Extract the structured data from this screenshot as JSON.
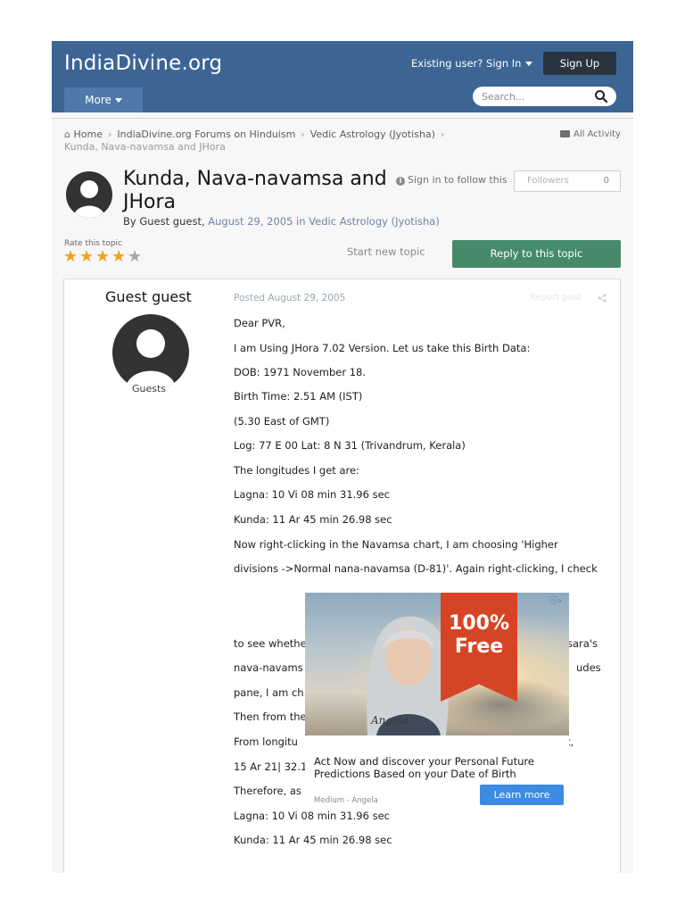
{
  "header": {
    "logo": "IndiaDivine.org",
    "signin": "Existing user? Sign In",
    "signup": "Sign Up",
    "more": "More",
    "search_placeholder": "Search..."
  },
  "breadcrumb": {
    "items": [
      "Home",
      "IndiaDivine.org Forums on Hinduism",
      "Vedic Astrology (Jyotisha)"
    ],
    "current": "Kunda, Nava-navamsa and JHora",
    "all_activity": "All Activity"
  },
  "topic": {
    "title": "Kunda, Nava-navamsa and JHora",
    "by_prefix": "By",
    "author": "Guest guest,",
    "date_forum": "August 29, 2005 in Vedic Astrology (Jyotisha)",
    "follow": "Sign in to follow this",
    "followers_label": "Followers",
    "followers_count": "0",
    "rate_label": "Rate this topic",
    "rating": 4,
    "rating_max": 5,
    "start_new": "Start new topic",
    "reply": "Reply to this topic"
  },
  "post": {
    "author": "Guest guest",
    "group": "Guests",
    "posted": "Posted August 29, 2005",
    "report": "Report post",
    "lines": [
      "Dear PVR,",
      "I am Using JHora 7.02 Version. Let us take this Birth Data:",
      "DOB: 1971 November 18.",
      "Birth Time: 2.51 AM (IST)",
      "(5.30 East of GMT)",
      "Log: 77 E 00 Lat: 8 N 31 (Trivandrum, Kerala)",
      "The longitudes I get are:",
      "Lagna: 10 Vi 08 min 31.96 sec",
      "Kunda: 11 Ar 45 min 26.98 sec",
      "Now right-clicking in the Navamsa chart, I am choosing 'Higher",
      "divisions ->Normal nana-navamsa (D-81)'. Again right-clicking, I check"
    ],
    "partial": {
      "l1_left": "to see whethe",
      "l1_right": "sara's",
      "l2_left": "nava-navams",
      "l2_right": "udes",
      "l3_left": "pane, I am ch",
      "l4_left": "Then from the",
      "l5_left": "From longitu",
      "l5_right": "t,",
      "l6_left": "15 Ar 21| 32.1"
    },
    "tail": [
      "Therefore, as per JHora,",
      "Lagna: 10 Vi 08 min 31.96 sec",
      "Kunda: 11 Ar 45 min 26.98 sec"
    ]
  },
  "ad": {
    "badge_line1": "100%",
    "badge_line2": "Free",
    "signature": "Angela",
    "headline": "Act Now and discover your Personal Future Predictions Based on your Date of Birth",
    "source": "Medium - Angela",
    "cta": "Learn more",
    "choices_icon": "adchoices-icon"
  }
}
